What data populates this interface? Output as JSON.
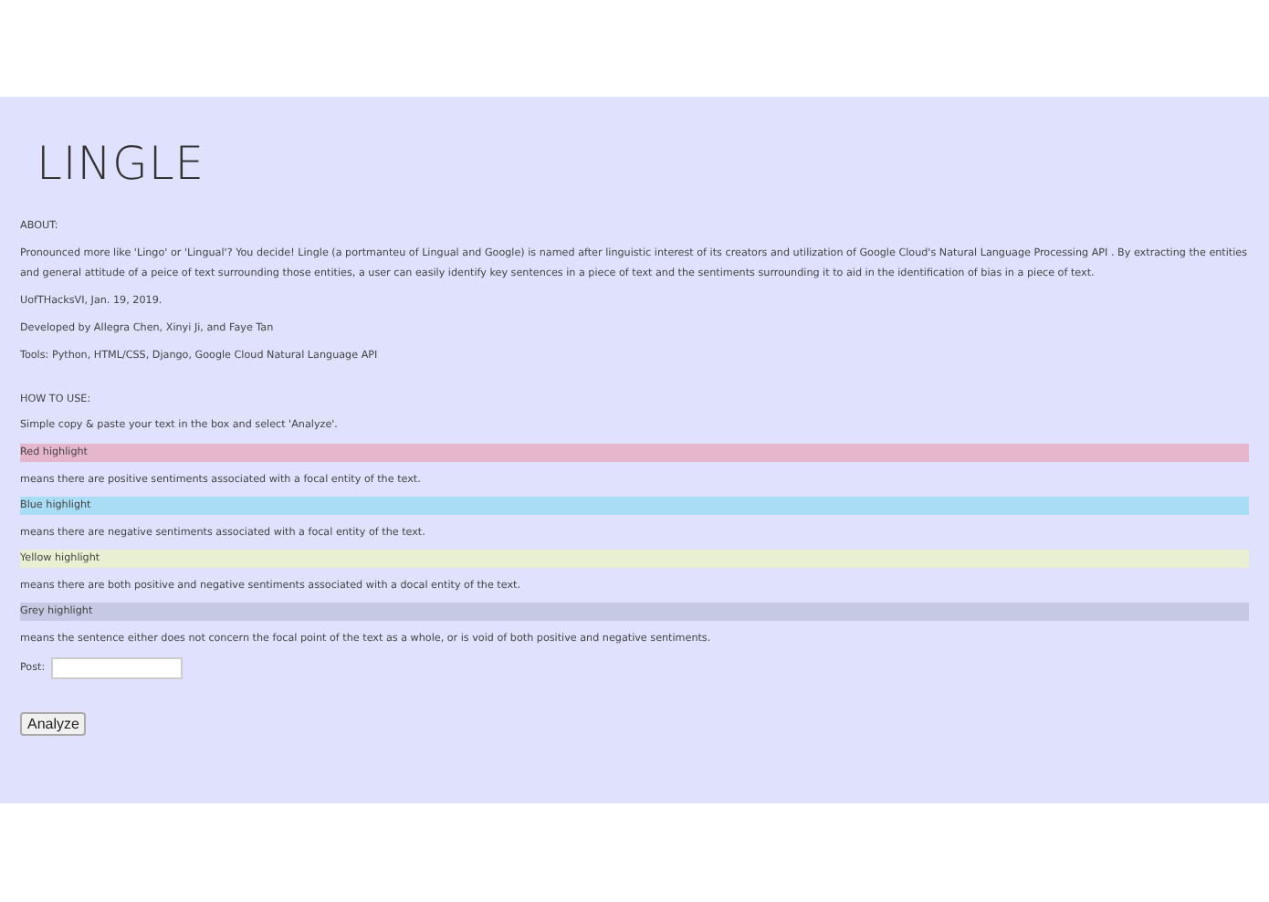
{
  "title": "LINGLE",
  "about": {
    "heading": "ABOUT:",
    "paragraphs": [
      "Pronounced more like 'Lingo' or 'Lingual'? You decide! Lingle (a portmanteu of Lingual and Google) is named after linguistic interest of its creators and utilization of Google Cloud's Natural Language Processing API . By extracting the entities and general attitude of a peice of text surrounding those entities, a user can easily identify key sentences in a piece of text and the sentiments surrounding it to aid in the identification of bias in a piece of text.",
      "UofTHacksVI, Jan. 19, 2019.",
      "Developed by Allegra Chen, Xinyi Ji, and Faye Tan",
      "Tools: Python, HTML/CSS, Django, Google Cloud Natural Language API"
    ]
  },
  "how_to_use": {
    "heading": "HOW TO USE:",
    "instruction": "Simple copy & paste your text in the box and select 'Analyze'.",
    "legend": [
      {
        "label": "Red highlight",
        "color": "#e6b6cc",
        "meaning": "means there are positive sentiments associated with a focal entity of the text."
      },
      {
        "label": "Blue highlight",
        "color": "#a9dcf5",
        "meaning": "means there are negative sentiments associated with a focal entity of the text."
      },
      {
        "label": "Yellow highlight",
        "color": "#e9efd2",
        "meaning": "means there are both positive and negative sentiments associated with a docal entity of the text."
      },
      {
        "label": "Grey highlight",
        "color": "#c6c9e3",
        "meaning": "means the sentence either does not concern the focal point of the text as a whole, or is void of both positive and negative sentiments."
      }
    ]
  },
  "form": {
    "label": "Post:",
    "button": "Analyze"
  }
}
